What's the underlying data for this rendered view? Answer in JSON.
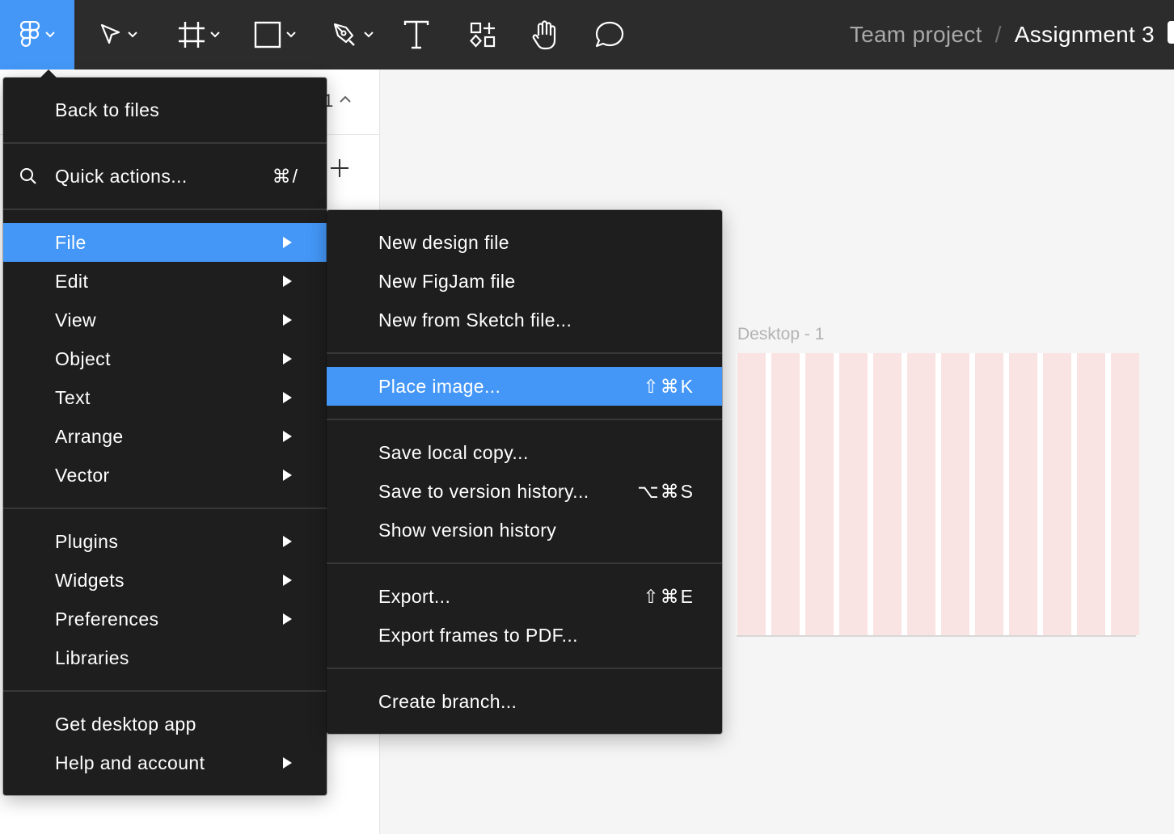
{
  "breadcrumb": {
    "project": "Team project",
    "separator": "/",
    "file": "Assignment 3"
  },
  "toolbar": {
    "tools": [
      "figma-logo-icon",
      "move-tool-icon",
      "frame-tool-icon",
      "shape-tool-icon",
      "pen-tool-icon",
      "text-tool-icon",
      "resources-icon",
      "hand-tool-icon",
      "comment-icon"
    ]
  },
  "left_panel": {
    "pages_count": "1"
  },
  "canvas": {
    "frame_label": "Desktop - 1",
    "grid_color": "#fae4e3"
  },
  "main_menu": {
    "back": "Back to files",
    "quick_actions": {
      "label": "Quick actions...",
      "shortcut": "⌘/"
    },
    "items": [
      {
        "label": "File"
      },
      {
        "label": "Edit"
      },
      {
        "label": "View"
      },
      {
        "label": "Object"
      },
      {
        "label": "Text"
      },
      {
        "label": "Arrange"
      },
      {
        "label": "Vector"
      },
      {
        "label": "Plugins"
      },
      {
        "label": "Widgets"
      },
      {
        "label": "Preferences"
      },
      {
        "label": "Libraries"
      },
      {
        "label": "Get desktop app"
      },
      {
        "label": "Help and account"
      }
    ]
  },
  "file_menu": {
    "items": [
      {
        "label": "New design file",
        "shortcut": ""
      },
      {
        "label": "New FigJam file",
        "shortcut": ""
      },
      {
        "label": "New from Sketch file...",
        "shortcut": ""
      },
      {
        "label": "Place image...",
        "shortcut": "⇧⌘K"
      },
      {
        "label": "Save local copy...",
        "shortcut": ""
      },
      {
        "label": "Save to version history...",
        "shortcut": "⌥⌘S"
      },
      {
        "label": "Show version history",
        "shortcut": ""
      },
      {
        "label": "Export...",
        "shortcut": "⇧⌘E"
      },
      {
        "label": "Export frames to PDF...",
        "shortcut": ""
      },
      {
        "label": "Create branch...",
        "shortcut": ""
      }
    ]
  },
  "colors": {
    "accent": "#4497f7",
    "menu_bg": "#1e1e1e",
    "toolbar_bg": "#2c2c2c"
  }
}
